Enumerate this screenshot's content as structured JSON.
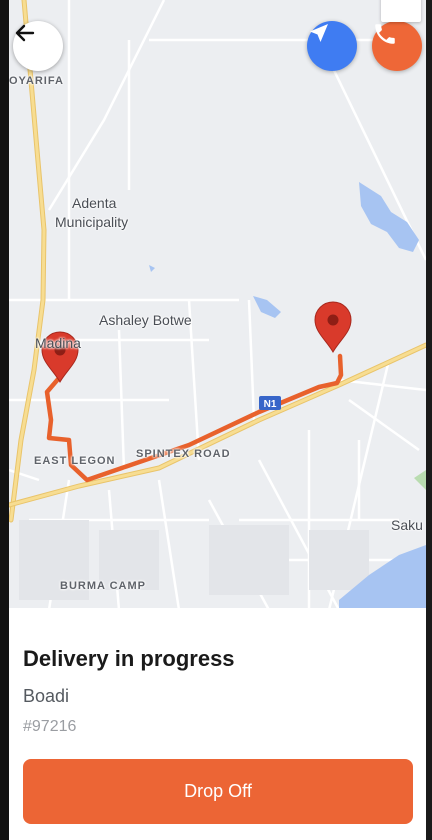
{
  "map": {
    "labels": {
      "oyarifa": "OYARIFA",
      "adenta_line1": "Adenta",
      "adenta_line2": "Municipality",
      "ashaley": "Ashaley Botwe",
      "madina": "Madina",
      "east_legon": "EAST LEGON",
      "spintex": "SPINTEX ROAD",
      "burma": "BURMA CAMP",
      "saku": "Saku",
      "n1": "N1"
    },
    "colors": {
      "route": "#e8612c",
      "pin": "#d93a2b",
      "water": "#a7c4f2",
      "highway": "#f5d27a"
    }
  },
  "controls": {
    "back_icon": "arrow-left-icon",
    "navigate_icon": "navigation-arrow-icon",
    "call_icon": "phone-icon",
    "locate_icon": "location-pin-icon"
  },
  "delivery": {
    "status_title": "Delivery in progress",
    "customer_name": "Boadi",
    "order_number": "#97216",
    "action_label": "Drop Off"
  },
  "colors": {
    "accent": "#ec6535",
    "nav_blue": "#3f7cf2"
  }
}
